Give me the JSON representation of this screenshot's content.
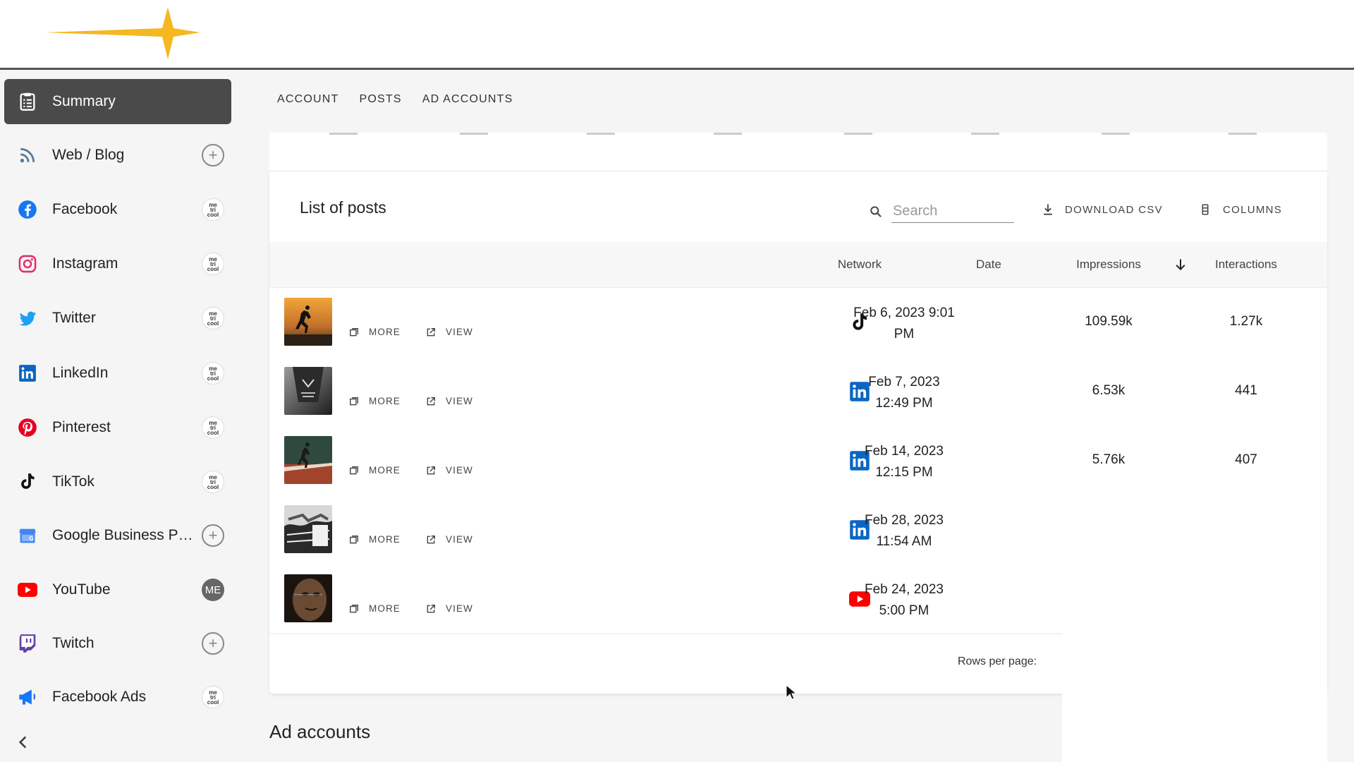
{
  "sidebar": {
    "items": [
      {
        "label": "Summary",
        "icon": "clipboard-icon",
        "badge": "none"
      },
      {
        "label": "Web / Blog",
        "icon": "rss-icon",
        "badge": "plus"
      },
      {
        "label": "Facebook",
        "icon": "facebook-icon",
        "badge": "metricool"
      },
      {
        "label": "Instagram",
        "icon": "instagram-icon",
        "badge": "metricool"
      },
      {
        "label": "Twitter",
        "icon": "twitter-icon",
        "badge": "metricool"
      },
      {
        "label": "LinkedIn",
        "icon": "linkedin-icon",
        "badge": "metricool"
      },
      {
        "label": "Pinterest",
        "icon": "pinterest-icon",
        "badge": "metricool"
      },
      {
        "label": "TikTok",
        "icon": "tiktok-icon",
        "badge": "metricool"
      },
      {
        "label": "Google Business Profile",
        "icon": "google-business-icon",
        "badge": "plus"
      },
      {
        "label": "YouTube",
        "icon": "youtube-icon",
        "badge": "ME"
      },
      {
        "label": "Twitch",
        "icon": "twitch-icon",
        "badge": "plus"
      },
      {
        "label": "Facebook Ads",
        "icon": "megaphone-icon",
        "badge": "metricool"
      }
    ],
    "badge_text_lines": [
      "me",
      "tri",
      "cool"
    ]
  },
  "tabs": [
    "ACCOUNT",
    "POSTS",
    "AD ACCOUNTS"
  ],
  "list": {
    "title": "List of posts",
    "search_placeholder": "Search",
    "download_label": "DOWNLOAD CSV",
    "columns_label": "COLUMNS",
    "headers": {
      "network": "Network",
      "date": "Date",
      "impressions": "Impressions",
      "interactions": "Interactions"
    },
    "more_label": "MORE",
    "view_label": "VIEW",
    "rows": [
      {
        "network": "tiktok",
        "date_line1": "Feb 6, 2023 9:01",
        "date_line2": "PM",
        "impressions": "109.59k",
        "interactions": "1.27k"
      },
      {
        "network": "linkedin",
        "date_line1": "Feb 7, 2023",
        "date_line2": "12:49 PM",
        "impressions": "6.53k",
        "interactions": "441"
      },
      {
        "network": "linkedin",
        "date_line1": "Feb 14, 2023",
        "date_line2": "12:15 PM",
        "impressions": "5.76k",
        "interactions": "407"
      },
      {
        "network": "linkedin",
        "date_line1": "Feb 28, 2023",
        "date_line2": "11:54 AM",
        "impressions": "",
        "interactions": ""
      },
      {
        "network": "youtube",
        "date_line1": "Feb 24, 2023",
        "date_line2": "5:00 PM",
        "impressions": "",
        "interactions": ""
      }
    ],
    "rows_per_page_label": "Rows per page:"
  },
  "ad_accounts_title": "Ad accounts",
  "colors": {
    "accent_star": "#f5b820",
    "active_nav": "#4a4a4a",
    "facebook": "#1877f2",
    "linkedin": "#0a66c2",
    "youtube": "#ff0000",
    "pinterest": "#e60023",
    "twitch": "#6441a5",
    "twitter": "#1da1f2"
  }
}
